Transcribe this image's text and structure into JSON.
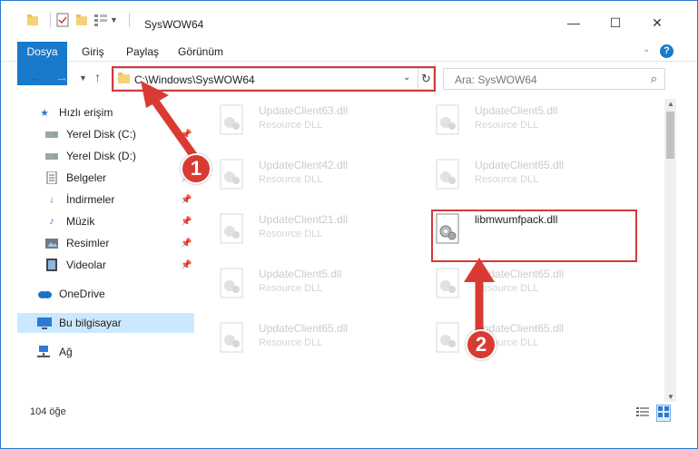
{
  "window": {
    "title": "SysWOW64",
    "accent": "#1979ca",
    "minimize": "—",
    "maximize": "☐",
    "close": "✕"
  },
  "ribbon": {
    "tabs": [
      "Dosya",
      "Giriş",
      "Paylaş",
      "Görünüm"
    ],
    "help": "?"
  },
  "address": {
    "path": "C:\\Windows\\SysWOW64",
    "search_placeholder": "Ara: SysWOW64"
  },
  "nav": {
    "items": [
      {
        "label": "Hızlı erişim",
        "icon": "star-icon"
      },
      {
        "label": "Yerel Disk (C:)",
        "icon": "drive-icon",
        "pinned": true
      },
      {
        "label": "Yerel Disk (D:)",
        "icon": "drive-icon"
      },
      {
        "label": "Belgeler",
        "icon": "documents-icon",
        "pinned": true
      },
      {
        "label": "İndirmeler",
        "icon": "downloads-icon",
        "pinned": true
      },
      {
        "label": "Müzik",
        "icon": "music-icon",
        "pinned": true
      },
      {
        "label": "Resimler",
        "icon": "pictures-icon",
        "pinned": true
      },
      {
        "label": "Videolar",
        "icon": "videos-icon",
        "pinned": true
      },
      {
        "label": "OneDrive",
        "icon": "cloud-icon"
      },
      {
        "label": "Bu bilgisayar",
        "icon": "computer-icon",
        "selected": true
      },
      {
        "label": "Ağ",
        "icon": "network-icon"
      }
    ]
  },
  "files": [
    {
      "name": "UpdateClient63.dll",
      "type": "Resource DLL"
    },
    {
      "name": "UpdateClient5.dll",
      "type": "Resource DLL"
    },
    {
      "name": "UpdateClient42.dll",
      "type": "Resource DLL"
    },
    {
      "name": "UpdateClient65.dll",
      "type": "Resource DLL"
    },
    {
      "name": "UpdateClient21.dll",
      "type": "Resource DLL"
    },
    {
      "name": "libmwumfpack.dll",
      "type": ""
    },
    {
      "name": "UpdateClient5.dll",
      "type": "Resource DLL"
    },
    {
      "name": "UpdateClient65.dll",
      "type": "Resource DLL"
    },
    {
      "name": "UpdateClient65.dll",
      "type": "Resource DLL"
    },
    {
      "name": "UpdateClient65.dll",
      "type": "Resource DLL"
    }
  ],
  "status": {
    "count": "104 öğe"
  },
  "callouts": {
    "one": "1",
    "two": "2",
    "color": "#d93b33"
  }
}
